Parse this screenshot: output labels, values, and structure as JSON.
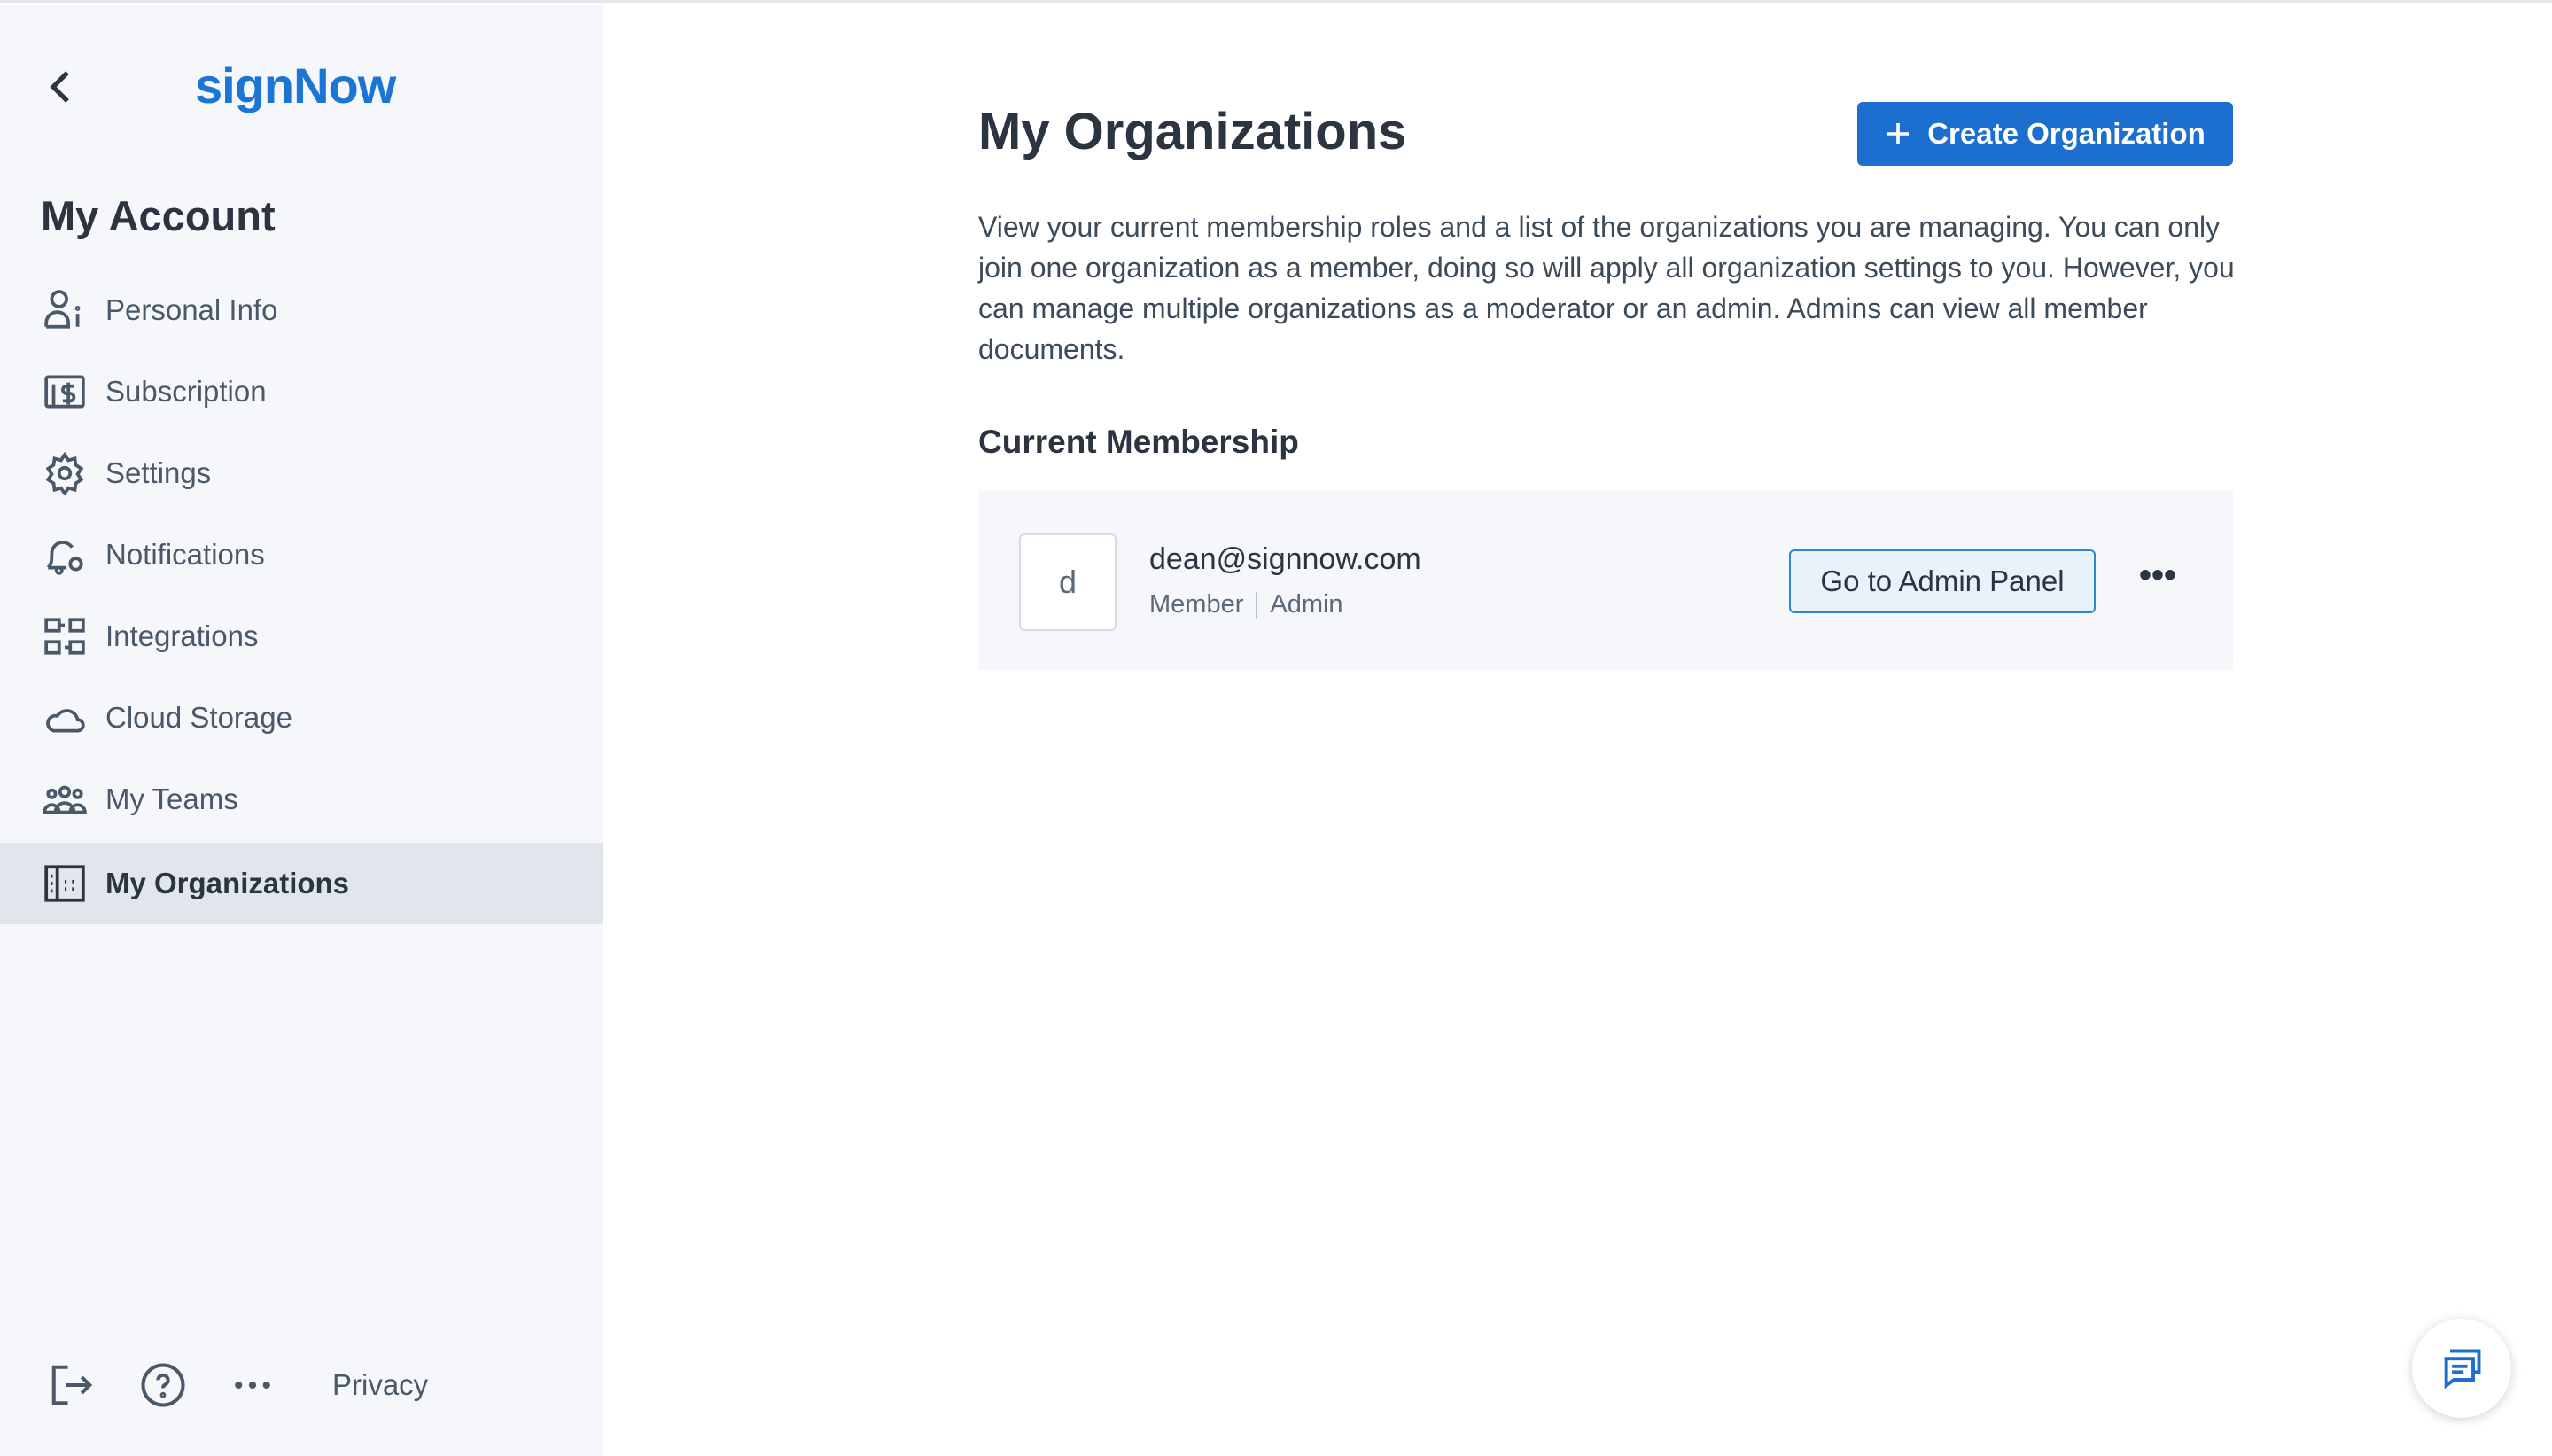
{
  "sidebar": {
    "logo": "signNow",
    "heading": "My Account",
    "items": [
      {
        "label": "Personal Info",
        "icon": "person-info-icon"
      },
      {
        "label": "Subscription",
        "icon": "dollar-icon"
      },
      {
        "label": "Settings",
        "icon": "gear-icon"
      },
      {
        "label": "Notifications",
        "icon": "bell-gear-icon"
      },
      {
        "label": "Integrations",
        "icon": "integrations-icon"
      },
      {
        "label": "Cloud Storage",
        "icon": "cloud-icon"
      },
      {
        "label": "My Teams",
        "icon": "team-icon"
      },
      {
        "label": "My Organizations",
        "icon": "building-icon",
        "active": true
      }
    ],
    "footer": {
      "privacy": "Privacy"
    }
  },
  "main": {
    "title": "My Organizations",
    "create_button": "Create Organization",
    "description": "View your current membership roles and a list of the organizations you are managing. You can only join one organization as a member, doing so will apply all organization settings to you. However, you can manage multiple organizations as a moderator or an admin. Admins can view all member documents.",
    "membership_heading": "Current Membership",
    "membership": {
      "avatar_letter": "d",
      "email": "dean@signnow.com",
      "role_1": "Member",
      "role_2": "Admin",
      "admin_button": "Go to Admin Panel",
      "more": "•••"
    }
  },
  "colors": {
    "brand": "#1a76d2",
    "primary_button": "#1c6fcf",
    "sidebar_bg": "#f5f7fa",
    "active_bg": "#e1e6ed"
  }
}
